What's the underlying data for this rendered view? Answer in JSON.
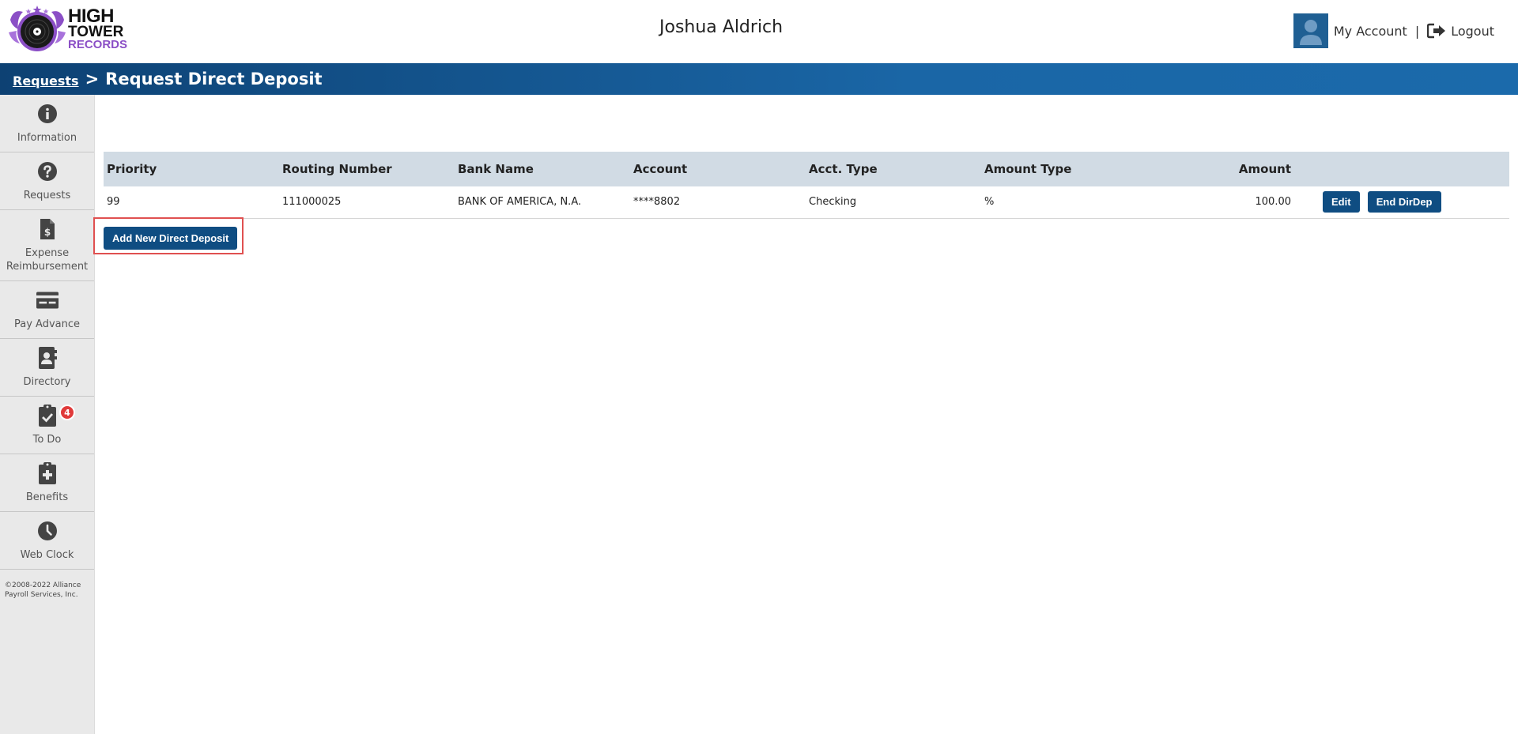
{
  "header": {
    "logo_line1": "HIGH",
    "logo_line2": "TOWER",
    "logo_line3": "RECORDS",
    "user_name": "Joshua Aldrich",
    "my_account": "My Account",
    "separator": "|",
    "logout": "Logout"
  },
  "breadcrumb": {
    "link": "Requests",
    "separator": ">",
    "title": "Request Direct Deposit"
  },
  "sidebar": {
    "items": [
      {
        "label": "Information",
        "icon": "info-circle-icon"
      },
      {
        "label": "Requests",
        "icon": "question-circle-icon"
      },
      {
        "label": "Expense Reimbursement",
        "icon": "dollar-document-icon"
      },
      {
        "label": "Pay Advance",
        "icon": "credit-card-icon"
      },
      {
        "label": "Directory",
        "icon": "address-book-icon"
      },
      {
        "label": "To Do",
        "icon": "clipboard-check-icon",
        "badge": "4"
      },
      {
        "label": "Benefits",
        "icon": "clipboard-plus-icon"
      },
      {
        "label": "Web Clock",
        "icon": "clock-icon"
      }
    ],
    "copyright": "©2008-2022 Alliance Payroll Services, Inc."
  },
  "table": {
    "headers": [
      "Priority",
      "Routing Number",
      "Bank Name",
      "Account",
      "Acct. Type",
      "Amount Type",
      "Amount"
    ],
    "rows": [
      {
        "priority": "99",
        "routing": "111000025",
        "bank": "BANK OF AMERICA, N.A.",
        "account": "****8802",
        "acct_type": "Checking",
        "amount_type": "%",
        "amount": "100.00",
        "edit_label": "Edit",
        "end_label": "End DirDep"
      }
    ]
  },
  "add_button_label": "Add New Direct Deposit",
  "colors": {
    "brand_blue": "#0f4d82",
    "header_row": "#d1dbe4",
    "sidebar_bg": "#e9e9e9",
    "highlight_border": "#e05050",
    "badge_red": "#e03a3a",
    "logo_purple": "#8b4fc6"
  }
}
